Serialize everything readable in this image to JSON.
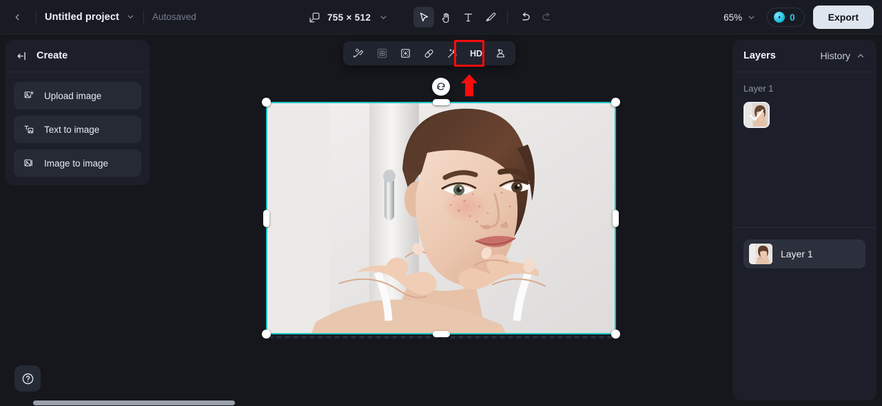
{
  "app": {
    "accent_teal": "#18c8c8",
    "accent_cyan": "#2fc6e8",
    "annotation_red": "#f90d0d",
    "panel_bg": "#1c1f29",
    "canvas_bg": "#16171d"
  },
  "topbar": {
    "back_icon": "chevron-left-icon",
    "project_name": "Untitled project",
    "project_caret_icon": "chevron-down-icon",
    "autosaved_label": "Autosaved",
    "canvas_size_icon": "canvas-resize-icon",
    "canvas_size": "755 × 512",
    "canvas_size_caret_icon": "chevron-down-icon",
    "tools": [
      {
        "name": "select-tool",
        "icon": "cursor-arrow-icon",
        "active": true,
        "disabled": false
      },
      {
        "name": "hand-tool",
        "icon": "hand-icon",
        "active": false,
        "disabled": false
      },
      {
        "name": "text-tool",
        "icon": "text-t-icon",
        "active": false,
        "disabled": false
      },
      {
        "name": "brush-tool",
        "icon": "paint-brush-icon",
        "active": false,
        "disabled": false
      },
      {
        "name": "undo",
        "icon": "undo-arrow-icon",
        "active": false,
        "disabled": false
      },
      {
        "name": "redo",
        "icon": "redo-arrow-icon",
        "active": false,
        "disabled": true
      }
    ],
    "zoom_level": "65%",
    "zoom_caret_icon": "chevron-down-icon",
    "credits_icon": "credit-orb-icon",
    "credits_count": "0",
    "export_label": "Export"
  },
  "left_panel": {
    "collapse_icon": "collapse-panel-icon",
    "title": "Create",
    "items": [
      {
        "label": "Upload image",
        "icon": "upload-image-icon"
      },
      {
        "label": "Text to image",
        "icon": "text-to-image-icon"
      },
      {
        "label": "Image to image",
        "icon": "image-to-image-icon"
      }
    ]
  },
  "float_toolbar": {
    "highlighted_index": 4,
    "buttons": [
      {
        "label": "",
        "icon": "magic-eraser-icon",
        "name": "magic-eraser-button",
        "dim": false
      },
      {
        "label": "",
        "icon": "select-subject-icon",
        "name": "select-subject-button",
        "dim": true
      },
      {
        "label": "",
        "icon": "expand-canvas-icon",
        "name": "expand-canvas-button",
        "dim": false
      },
      {
        "label": "",
        "icon": "eraser-icon",
        "name": "eraser-button",
        "dim": false
      },
      {
        "label": "",
        "icon": "magic-wand-icon",
        "name": "ai-retouch-button",
        "dim": false
      },
      {
        "label": "HD",
        "icon": "hd-text-icon",
        "name": "hd-upscale-button",
        "dim": false
      },
      {
        "label": "",
        "icon": "face-retouch-icon",
        "name": "face-retouch-button",
        "dim": false
      }
    ]
  },
  "canvas": {
    "rotate_icon": "rotate-handle-icon",
    "annotation_arrow_icon": "red-up-arrow-icon",
    "image_alt": "young-woman-touching-face-photo"
  },
  "right_panel": {
    "title": "Layers",
    "history_label": "History",
    "history_caret_icon": "chevron-up-icon",
    "history_group_label": "Layer 1",
    "history_thumb_check_icon": "check-icon",
    "layers": [
      {
        "label": "Layer 1",
        "thumb": "layer-thumbnail"
      }
    ]
  },
  "bottom": {
    "help_icon": "help-circle-icon",
    "scrollbar": "horizontal-scrollbar"
  }
}
